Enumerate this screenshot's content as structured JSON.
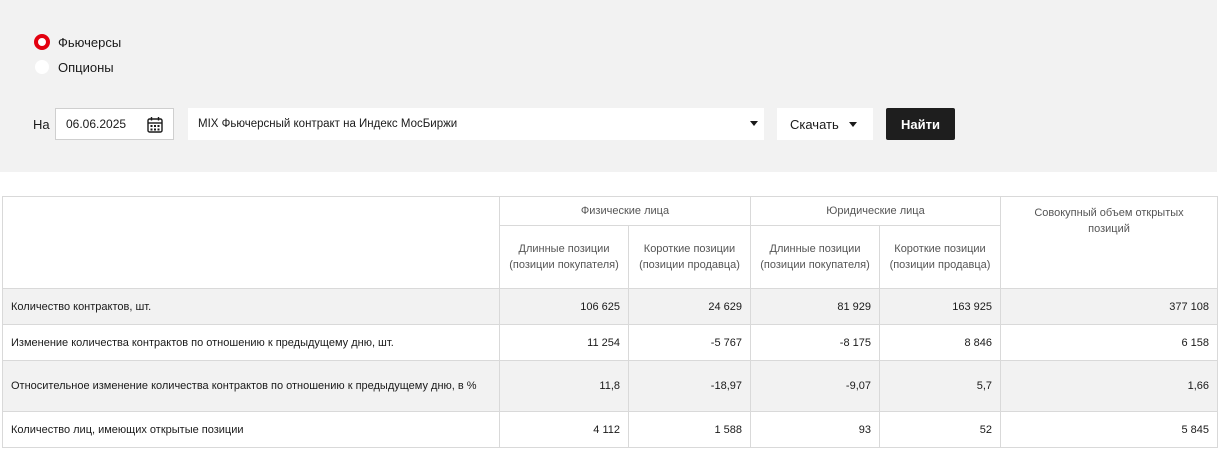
{
  "filters": {
    "radio_futures": "Фьючерсы",
    "radio_options": "Опционы",
    "date_label": "На",
    "date_value": "06.06.2025",
    "contract_select": "MIX Фьючерсный контракт на Индекс МосБиржи",
    "download_label": "Скачать",
    "find_label": "Найти",
    "selected": "futures",
    "accent_color": "#e3000f"
  },
  "table": {
    "group_individuals": "Физические лица",
    "group_legal": "Юридические лица",
    "total_header": "Совокупный объем открытых позиций",
    "sub_long": "Длинные позиции (позиции покупателя)",
    "sub_short": "Короткие позиции (позиции продавца)",
    "rows": [
      {
        "label": "Количество контрактов, шт.",
        "values": [
          "106 625",
          "24 629",
          "81 929",
          "163 925",
          "377 108"
        ]
      },
      {
        "label": "Изменение количества контрактов по отношению к предыдущему дню, шт.",
        "values": [
          "11 254",
          "-5 767",
          "-8 175",
          "8 846",
          "6 158"
        ]
      },
      {
        "label": "Относительное изменение количества контрактов по отношению к предыдущему дню, в %",
        "values": [
          "11,8",
          "-18,97",
          "-9,07",
          "5,7",
          "1,66"
        ]
      },
      {
        "label": "Количество лиц, имеющих открытые позиции",
        "values": [
          "4 112",
          "1 588",
          "93",
          "52",
          "5 845"
        ]
      }
    ]
  }
}
